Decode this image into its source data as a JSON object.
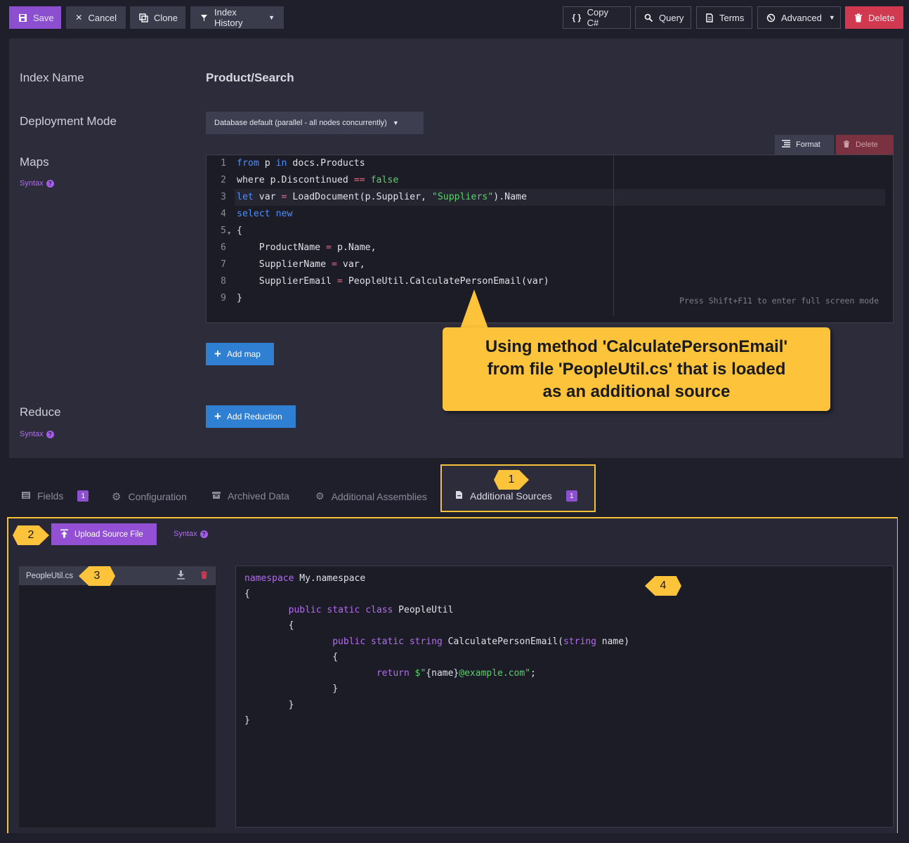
{
  "toolbar": {
    "save": "Save",
    "cancel": "Cancel",
    "clone": "Clone",
    "index_history": "Index History",
    "copy_csharp": "Copy C#",
    "query": "Query",
    "terms": "Terms",
    "advanced": "Advanced",
    "delete": "Delete"
  },
  "form": {
    "index_name_label": "Index Name",
    "index_name_value": "Product/Search",
    "deployment_label": "Deployment Mode",
    "deployment_value": "Database default (parallel - all nodes concurrently)",
    "maps_label": "Maps",
    "syntax_link": "Syntax",
    "format_btn": "Format",
    "delete_btn": "Delete",
    "editor_hint": "Press Shift+F11 to enter full screen mode",
    "add_map": "Add map",
    "reduce_label": "Reduce",
    "add_reduction": "Add Reduction"
  },
  "map_code": {
    "line_numbers": [
      "1",
      "2",
      "3",
      "4",
      "5",
      "6",
      "7",
      "8",
      "9"
    ]
  },
  "callout": {
    "line1": "Using method 'CalculatePersonEmail'",
    "line2": "from file 'PeopleUtil.cs' that is loaded",
    "line3": "as an additional source"
  },
  "tabs": {
    "fields": "Fields",
    "fields_count": "1",
    "configuration": "Configuration",
    "archived": "Archived Data",
    "assemblies": "Additional Assemblies",
    "sources": "Additional Sources",
    "sources_count": "1"
  },
  "bottom": {
    "upload": "Upload Source File",
    "syntax": "Syntax",
    "file_name": "PeopleUtil.cs"
  },
  "markers": [
    "1",
    "2",
    "3",
    "4"
  ],
  "colors": {
    "accent": "#8c4fd0",
    "danger": "#d0394f",
    "primary": "#2f7fd3",
    "callout": "#fcc33b"
  }
}
